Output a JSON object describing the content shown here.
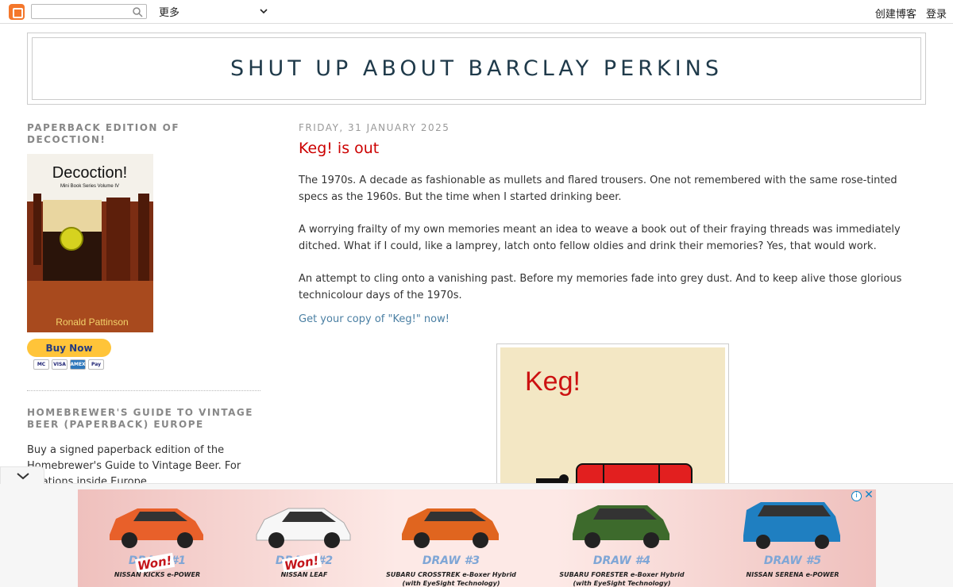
{
  "navbar": {
    "more_label": "更多",
    "create_blog": "创建博客",
    "login": "登录"
  },
  "header": {
    "blog_title": "SHUT UP ABOUT BARCLAY PERKINS"
  },
  "sidebar": {
    "widget1": {
      "title": "PAPERBACK EDITION OF DECOCTION!",
      "book_title": "Decoction!",
      "book_series": "Mini Book Series Volume IV",
      "book_author": "Ronald Pattinson",
      "buy_label": "Buy Now",
      "cards": [
        "MC",
        "VISA",
        "AMEX",
        "Pay"
      ]
    },
    "widget2": {
      "title": "HOMEBREWER'S GUIDE TO VINTAGE BEER (PAPERBACK) EUROPE",
      "text": "Buy a signed paperback edition of the Homebrewer's Guide to Vintage Beer. For locations inside Europe."
    }
  },
  "post": {
    "date": "FRIDAY, 31 JANUARY 2025",
    "title": "Keg! is out",
    "paragraphs": [
      "The 1970s. A decade as fashionable as mullets and flared trousers. One not remembered with the same rose-tinted specs as the 1960s. But the time when I started drinking beer.",
      "A worrying frailty of my own memories meant an idea to weave a book out of their fraying threads was immediately ditched. What if I could, like a lamprey, latch onto fellow oldies and drink their memories? Yes, that would work.",
      "An attempt to cling onto a vanishing past. Before my memories fade into grey dust. And to keep alive those glorious technicolour days of the 1970s."
    ],
    "link_text": "Get your copy of \"Keg!\" now!",
    "image_title": "Keg!"
  },
  "ad": {
    "won_label": "Won!",
    "items": [
      {
        "draw": "DRAW #1",
        "model": "NISSAN KICKS e-POWER",
        "won": true,
        "color": "#e8602a"
      },
      {
        "draw": "DRAW #2",
        "model": "NISSAN LEAF",
        "won": true,
        "color": "#f4f4f4"
      },
      {
        "draw": "DRAW #3",
        "model": "SUBARU CROSSTREK e-Boxer Hybrid (with EyeSight Technology)",
        "won": false,
        "color": "#e0651f"
      },
      {
        "draw": "DRAW #4",
        "model": "SUBARU FORESTER e-Boxer Hybrid (with EyeSight Technology)",
        "won": false,
        "color": "#3d6a2c"
      },
      {
        "draw": "DRAW #5",
        "model": "NISSAN SERENA e-POWER",
        "won": false,
        "color": "#1f7fc1"
      }
    ]
  }
}
